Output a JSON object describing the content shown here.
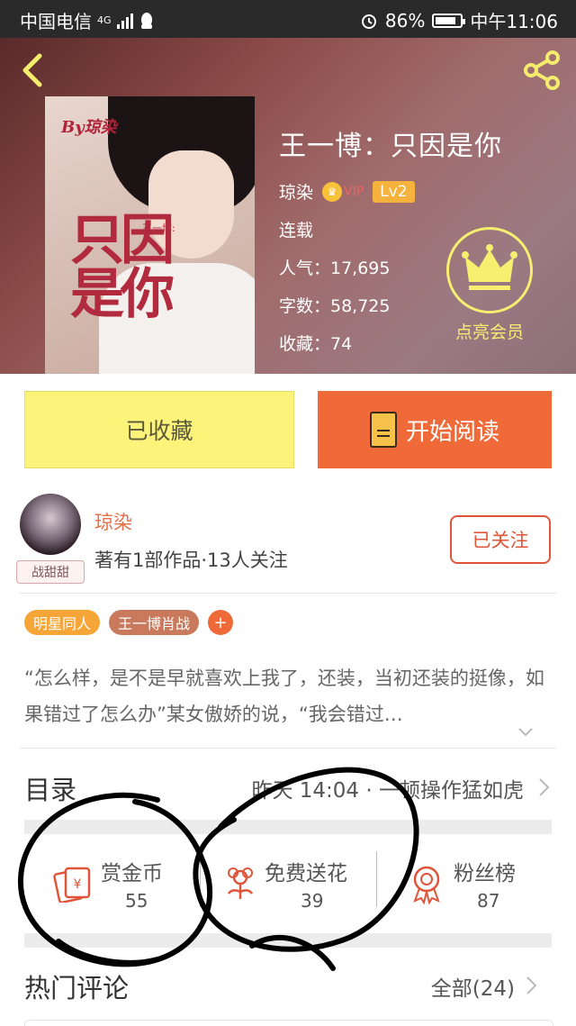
{
  "status_bar": {
    "carrier": "中国电信",
    "network": "4G",
    "battery": "86%",
    "time": "中午11:06"
  },
  "book": {
    "cover_by": "By琼染",
    "cover_sub": "王一博:",
    "cover_title_line1": "只因",
    "cover_title_line2": "是你",
    "title": "王一博：只因是你",
    "author": "琼染",
    "vip_label": "VIP",
    "level": "Lv2",
    "status": "连载",
    "popularity": "人气：17,695",
    "word_count": "字数：58,725",
    "collections": "收藏：74",
    "member_label": "点亮会员"
  },
  "actions": {
    "collected_label": "已收藏",
    "read_label": "开始阅读"
  },
  "author_section": {
    "name": "琼染",
    "meta": "著有1部作品·13人关注",
    "badge": "战甜甜",
    "follow_label": "已关注"
  },
  "tags": [
    "明星同人",
    "王一博肖战",
    "+"
  ],
  "description": "“怎么样，是不是早就喜欢上我了，还装，当初还装的挺像，如果错过了怎么办”某女傲娇的说，“我会错过…",
  "toc": {
    "label": "目录",
    "update": "昨天 14:04 · 一顿操作猛如虎"
  },
  "stats": [
    {
      "label": "赏金币",
      "value": "55"
    },
    {
      "label": "免费送花",
      "value": "39"
    },
    {
      "label": "粉丝榜",
      "value": "87"
    }
  ],
  "comments": {
    "label": "热门评论",
    "all_label": "全部(24)"
  },
  "colors": {
    "accent": "#ef6a38",
    "collected_bg": "#fcf37a",
    "member_yellow": "#f6ef70",
    "stat_red": "#e0553a"
  },
  "icons": [
    "back-arrow-icon",
    "share-icon",
    "crown-icon",
    "book-icon",
    "red-envelope-icon",
    "flower-icon",
    "medal-icon",
    "chevron-right-icon",
    "chevron-down-icon"
  ]
}
